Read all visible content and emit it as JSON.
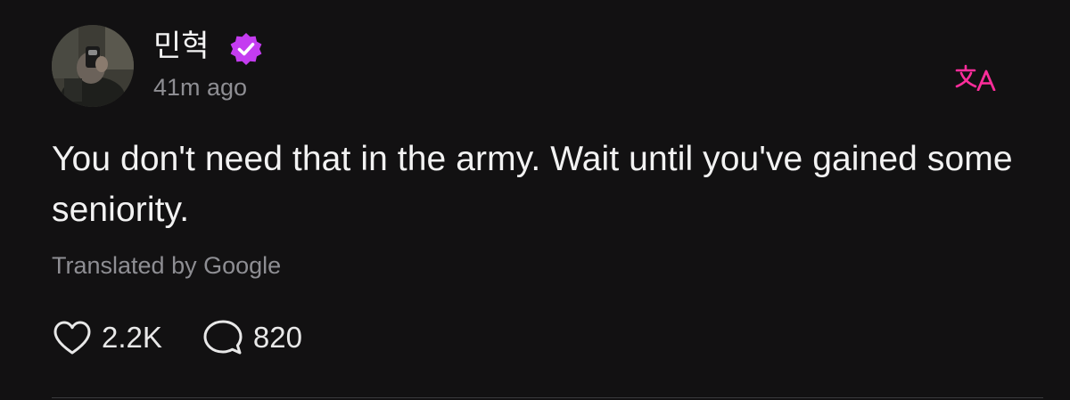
{
  "post": {
    "author": {
      "name": "민혁",
      "verified_icon": "verified-badge-icon",
      "avatar_icon": "avatar"
    },
    "timestamp": "41m ago",
    "body": "You don't need that in the army. Wait until you've gained some seniority.",
    "translation_note": "Translated by Google",
    "stats": {
      "likes": "2.2K",
      "comments": "820"
    }
  },
  "colors": {
    "background": "#121112",
    "accent_pink": "#ff2d9b",
    "verified_purple": "#c43cf0",
    "secondary_text": "#8e8e93"
  }
}
